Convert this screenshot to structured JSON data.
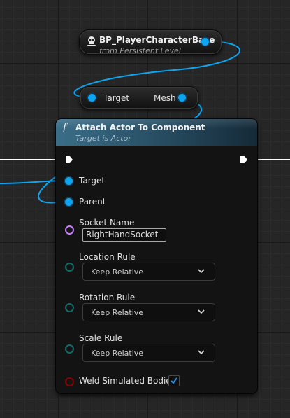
{
  "get_node": {
    "title": "BP_PlayerCharacterBase",
    "subtitle": "from Persistent Level"
  },
  "mesh_node": {
    "input_label": "Target",
    "output_label": "Mesh"
  },
  "function_node": {
    "icon_glyph": "f",
    "title": "Attach Actor To Component",
    "subtitle": "Target is Actor",
    "pins": {
      "target": "Target",
      "parent": "Parent"
    },
    "socket_name": {
      "label": "Socket Name",
      "value": "RightHandSocket"
    },
    "location_rule": {
      "label": "Location Rule",
      "value": "Keep Relative"
    },
    "rotation_rule": {
      "label": "Rotation Rule",
      "value": "Keep Relative"
    },
    "scale_rule": {
      "label": "Scale Rule",
      "value": "Keep Relative"
    },
    "weld": {
      "label": "Weld Simulated Bodies",
      "checked": true
    }
  },
  "colors": {
    "object_pin": "#0ea5f0",
    "name_pin": "#c77dff",
    "enum_pin": "#0f6b68",
    "bool_pin": "#8b0000",
    "header": "#2a5268"
  }
}
